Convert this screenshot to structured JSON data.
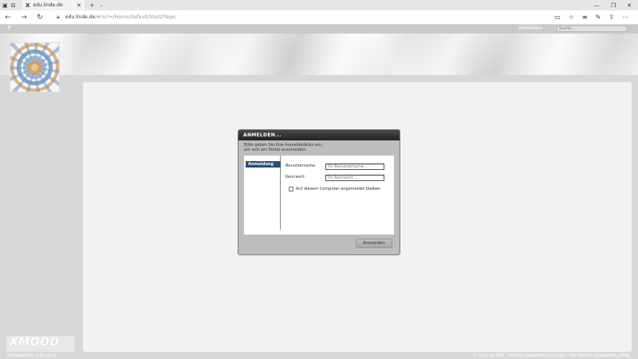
{
  "browser": {
    "tab_title": "edu.linde.de",
    "tab_favicon": "X",
    "url_host": "edu.linde.de",
    "url_path": "/#!url=/Home/Default/Start/Page/",
    "icons": [
      "back-arrow-icon",
      "forward-arrow-icon",
      "refresh-icon",
      "lock-icon",
      "reading-view-icon",
      "star-icon",
      "hub-icon",
      "pen-icon",
      "share-icon",
      "more-icon"
    ]
  },
  "page": {
    "login_link": "Anmelden",
    "search_placeholder": "Suche..."
  },
  "dialog": {
    "title": "ANMELDEN...",
    "description_line1": "Bitte geben Sie Ihre Anmeldedaten ein,",
    "description_line2": "um sich am Portal anzumelden.",
    "side_item": "Anmeldung",
    "username_label": "Benutzername:",
    "username_placeholder": "Ihr Benutzername...",
    "password_label": "Kennwort:",
    "password_placeholder": "Ihr Kennwort...",
    "remember_label": "Auf diesem Computer angemeldet bleiben",
    "login_button": "Anmelden"
  },
  "footer": {
    "logo_text": "XMOOD",
    "version": "Portalversion: 2.93 pfn 1",
    "copyright": "© 2017 by BDF - Brandle Datentechnik GmbH - Alle Rechte vorbehalten | Hilfe"
  },
  "colors": {
    "side_item_bg": "#2a4e78",
    "dialog_title_bg": "#222222",
    "content_bg": "#f2f2f2"
  }
}
